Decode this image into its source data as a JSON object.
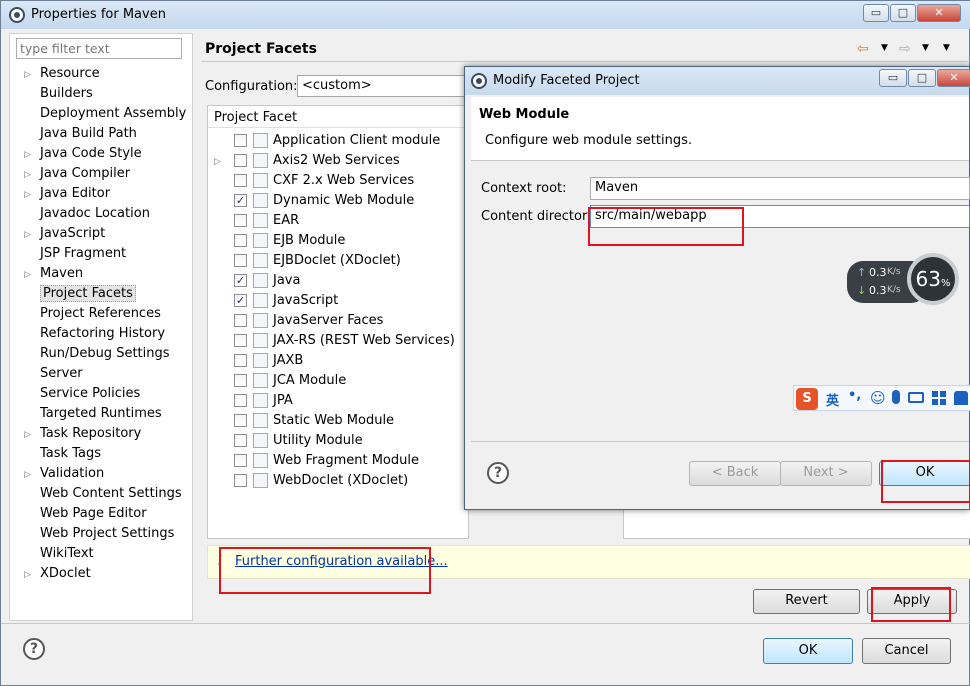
{
  "window": {
    "title": "Properties for Maven",
    "minimize": "▭",
    "maximize": "□",
    "close": "✕"
  },
  "filter": {
    "placeholder": "type filter text"
  },
  "nav": [
    {
      "label": "Resource",
      "expandable": true
    },
    {
      "label": "Builders",
      "expandable": false
    },
    {
      "label": "Deployment Assembly",
      "expandable": false
    },
    {
      "label": "Java Build Path",
      "expandable": false
    },
    {
      "label": "Java Code Style",
      "expandable": true
    },
    {
      "label": "Java Compiler",
      "expandable": true
    },
    {
      "label": "Java Editor",
      "expandable": true
    },
    {
      "label": "Javadoc Location",
      "expandable": false
    },
    {
      "label": "JavaScript",
      "expandable": true
    },
    {
      "label": "JSP Fragment",
      "expandable": false
    },
    {
      "label": "Maven",
      "expandable": true
    },
    {
      "label": "Project Facets",
      "expandable": false,
      "selected": true
    },
    {
      "label": "Project References",
      "expandable": false
    },
    {
      "label": "Refactoring History",
      "expandable": false
    },
    {
      "label": "Run/Debug Settings",
      "expandable": false
    },
    {
      "label": "Server",
      "expandable": false
    },
    {
      "label": "Service Policies",
      "expandable": false
    },
    {
      "label": "Targeted Runtimes",
      "expandable": false
    },
    {
      "label": "Task Repository",
      "expandable": true
    },
    {
      "label": "Task Tags",
      "expandable": false
    },
    {
      "label": "Validation",
      "expandable": true
    },
    {
      "label": "Web Content Settings",
      "expandable": false
    },
    {
      "label": "Web Page Editor",
      "expandable": false
    },
    {
      "label": "Web Project Settings",
      "expandable": false
    },
    {
      "label": "WikiText",
      "expandable": false
    },
    {
      "label": "XDoclet",
      "expandable": true
    }
  ],
  "page": {
    "title": "Project Facets",
    "config_label": "Configuration:",
    "config_value": "<custom>",
    "facet_header": "Project Facet"
  },
  "facets": [
    {
      "label": "Application Client module",
      "checked": false,
      "expandable": false
    },
    {
      "label": "Axis2 Web Services",
      "checked": false,
      "expandable": true
    },
    {
      "label": "CXF 2.x Web Services",
      "checked": false,
      "expandable": false
    },
    {
      "label": "Dynamic Web Module",
      "checked": true,
      "expandable": false
    },
    {
      "label": "EAR",
      "checked": false,
      "expandable": false
    },
    {
      "label": "EJB Module",
      "checked": false,
      "expandable": false
    },
    {
      "label": "EJBDoclet (XDoclet)",
      "checked": false,
      "expandable": false
    },
    {
      "label": "Java",
      "checked": true,
      "expandable": false
    },
    {
      "label": "JavaScript",
      "checked": true,
      "expandable": false
    },
    {
      "label": "JavaServer Faces",
      "checked": false,
      "expandable": false
    },
    {
      "label": "JAX-RS (REST Web Services)",
      "checked": false,
      "expandable": false
    },
    {
      "label": "JAXB",
      "checked": false,
      "expandable": false
    },
    {
      "label": "JCA Module",
      "checked": false,
      "expandable": false
    },
    {
      "label": "JPA",
      "checked": false,
      "expandable": false
    },
    {
      "label": "Static Web Module",
      "checked": false,
      "expandable": false
    },
    {
      "label": "Utility Module",
      "checked": false,
      "expandable": false
    },
    {
      "label": "Web Fragment Module",
      "checked": false,
      "expandable": false
    },
    {
      "label": "WebDoclet (XDoclet)",
      "checked": false,
      "expandable": false
    }
  ],
  "info": {
    "icon": "i",
    "link": "Further configuration available..."
  },
  "buttons": {
    "revert": "Revert",
    "apply": "Apply",
    "ok": "OK",
    "cancel": "Cancel"
  },
  "dialog": {
    "title": "Modify Faceted Project",
    "heading": "Web Module",
    "description": "Configure web module settings.",
    "context_root_label": "Context root:",
    "context_root_value": "Maven",
    "content_dir_label": "Content directory:",
    "content_dir_value": "src/main/webapp",
    "back": "< Back",
    "next": "Next >",
    "ok": "OK"
  },
  "netmon": {
    "up": "0.3",
    "down": "0.3",
    "unit": "K/s",
    "percent": "63",
    "percent_sign": "%"
  },
  "ime": {
    "lang": "英",
    "punct": "•,"
  }
}
